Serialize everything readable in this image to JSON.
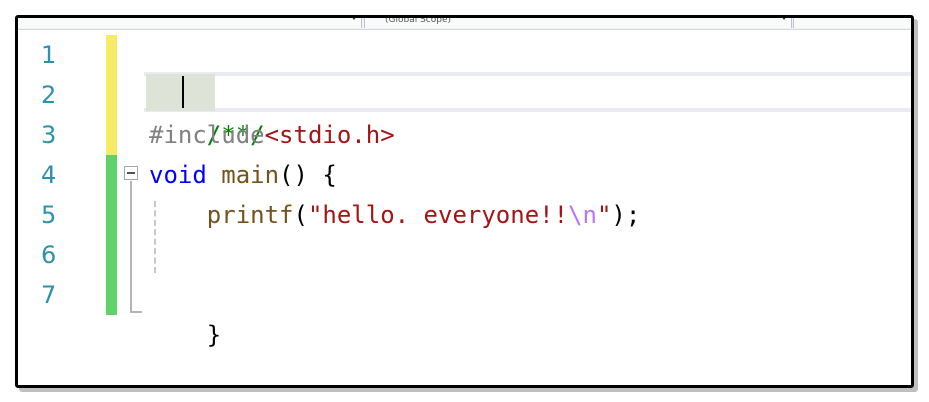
{
  "navbar": {
    "left_combo_value": "",
    "scope_combo_value": "(Global Scope)"
  },
  "editor": {
    "line_numbers": [
      "1",
      "2",
      "3",
      "4",
      "5",
      "6",
      "7"
    ],
    "lines": {
      "l2": {
        "comment": "/**/"
      },
      "l3": {
        "directive": "#include",
        "header": "<stdio.h>"
      },
      "l4": {
        "keyword": "void",
        "space1": " ",
        "func": "main",
        "punct": "() {"
      },
      "l5": {
        "indent": "    ",
        "func": "printf",
        "open": "(",
        "string1": "\"hello. everyone!!",
        "escape": "\\n",
        "string2": "\"",
        "close": ");"
      },
      "l7": {
        "brace": "}"
      }
    },
    "colors": {
      "line_number": "#2b91af",
      "comment": "#008000",
      "directive": "#808080",
      "header": "#a31515",
      "keyword": "#0000ff",
      "function": "#74531f",
      "string": "#a31515",
      "escape": "#b776fb",
      "saved_change_marker": "#5fd36a",
      "unsaved_change_marker": "#f7ea64"
    }
  }
}
